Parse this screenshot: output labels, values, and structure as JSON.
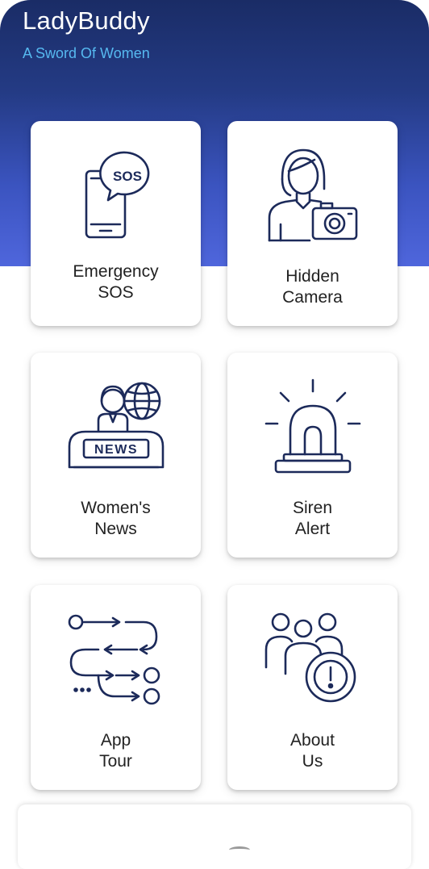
{
  "header": {
    "title": "LadyBuddy",
    "subtitle": "A Sword Of Women"
  },
  "cards": [
    {
      "line1": "Emergency",
      "line2": "SOS",
      "icon": "phone-sos-icon",
      "icon_text": "SOS"
    },
    {
      "line1": "Hidden",
      "line2": "Camera",
      "icon": "woman-camera-icon"
    },
    {
      "line1": "Women's",
      "line2": "News",
      "icon": "news-anchor-icon",
      "icon_text": "NEWS"
    },
    {
      "line1": "Siren",
      "line2": "Alert",
      "icon": "siren-icon"
    },
    {
      "line1": "App",
      "line2": "Tour",
      "icon": "flow-path-icon"
    },
    {
      "line1": "About",
      "line2": "Us",
      "icon": "group-info-icon"
    }
  ],
  "colors": {
    "header_top": "#1a2c66",
    "header_bottom": "#4f66dc",
    "subtitle": "#56b9f0",
    "icon_stroke": "#1c2a5a"
  }
}
